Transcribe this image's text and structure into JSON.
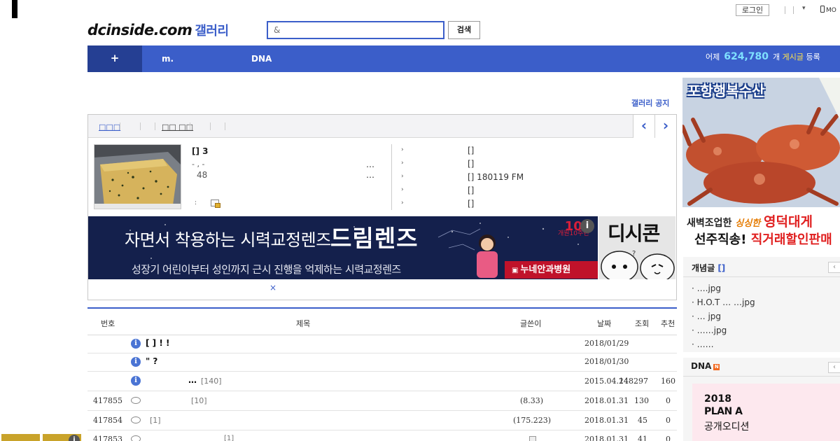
{
  "header": {
    "login_label": "로그인",
    "dropdown_caret": "▾",
    "mobile_label": "MO",
    "logo_text": "dcinside.com",
    "logo_gallery": "갤러리",
    "search_placeholder": "&",
    "search_button": "검색"
  },
  "nav": {
    "items": [
      "+",
      "m.",
      "DNA"
    ],
    "yesterday_label": "어제",
    "yesterday_count": "624,780",
    "count_unit": "개",
    "posts_label": "게시글",
    "registered_label": "등록",
    "color": "#3b5ec9",
    "active_color": "#253f93"
  },
  "gallery_notice": "갤러리 공지",
  "info_box": {
    "tab_a": "□□□",
    "tab_b": "□□ □□",
    "prev_arrow": "‹",
    "next_arrow": "›",
    "post_title": "[] 3",
    "post_meta": "- , -",
    "post_count": "48",
    "ellipsis": "…",
    "colon": ":",
    "side_bullet": "›",
    "side_entries": [
      "[]",
      "[]",
      "[] 180119   FM",
      "[]",
      "[]"
    ]
  },
  "banner": {
    "line1": "자면서 착용하는 시력교정렌즈",
    "brand": "드림렌즈",
    "line2": "성장기 어린이부터 성인까지 근시 진행을 억제하는 시력교정렌즈",
    "hospital": "누네안과병원",
    "badge_number": "10",
    "badge_text": "개원10주년",
    "info_mark": "i",
    "dc_con": "디시콘",
    "close": "×"
  },
  "table": {
    "headers": {
      "num": "번호",
      "title": "제목",
      "writer": "글쓴이",
      "date": "날짜",
      "views": "조회",
      "recommend": "추천"
    },
    "notices": [
      {
        "title": "[ ]   !   !",
        "date": "2018/01/29"
      },
      {
        "title": "\"   ?",
        "date": "2018/01/30"
      },
      {
        "title": "…",
        "comments": "[140]",
        "date": "2015.04.24",
        "views": "148297",
        "recommend": "160"
      }
    ],
    "rows": [
      {
        "num": "417855",
        "comments": "[10]",
        "writer": "(8.33)",
        "date": "2018.01.31",
        "views": "130",
        "recommend": "0"
      },
      {
        "num": "417854",
        "comments": "[1]",
        "writer": "(175.223)",
        "date": "2018.01.31",
        "views": "45",
        "recommend": "0"
      },
      {
        "num": "417853",
        "comments": "[1]",
        "writer": "",
        "date": "2018.01.31",
        "views": "41",
        "recommend": "0"
      }
    ]
  },
  "right_ad": {
    "title": "포항행복수산",
    "line1_a": "새벽조업한",
    "line1_b": "싱싱한",
    "line1_c": "영덕대게",
    "line2_a": "선주직송!",
    "line2_b": "직거래할인판매"
  },
  "concept": {
    "title": "개념글",
    "title_mark": "[]",
    "items": [
      "· ….jpg",
      "·  H.O.T …  …jpg",
      "·     … jpg",
      "·       ……jpg",
      "· ……"
    ]
  },
  "dna": {
    "title": "DNA",
    "badge": "N",
    "ad_year": "2018",
    "ad_name": "PLAN A",
    "ad_sub": "공개오디션"
  }
}
